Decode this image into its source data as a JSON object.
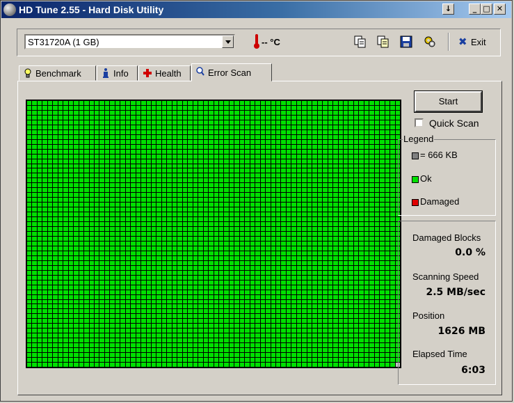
{
  "window": {
    "title": "HD Tune 2.55 - Hard Disk Utility"
  },
  "toolbar": {
    "drive": "ST31720A (1 GB)",
    "temperature": "-- °C",
    "exit_label": "Exit"
  },
  "tabs": [
    {
      "label": "Benchmark"
    },
    {
      "label": "Info"
    },
    {
      "label": "Health"
    },
    {
      "label": "Error Scan"
    }
  ],
  "controls": {
    "start_label": "Start",
    "quick_scan_label": "Quick Scan",
    "quick_scan_checked": false
  },
  "legend": {
    "title": "Legend",
    "block_size": "= 666 KB",
    "ok": "Ok",
    "damaged": "Damaged"
  },
  "stats": {
    "damaged_blocks_label": "Damaged Blocks",
    "damaged_blocks_value": "0.0 %",
    "scanning_speed_label": "Scanning Speed",
    "scanning_speed_value": "2.5 MB/sec",
    "position_label": "Position",
    "position_value": "1626 MB",
    "elapsed_label": "Elapsed Time",
    "elapsed_value": "6:03"
  },
  "colors": {
    "ok": "#00e000",
    "damaged": "#e00000",
    "pending": "#c0c0c0",
    "title_bar": "#0a246a"
  }
}
